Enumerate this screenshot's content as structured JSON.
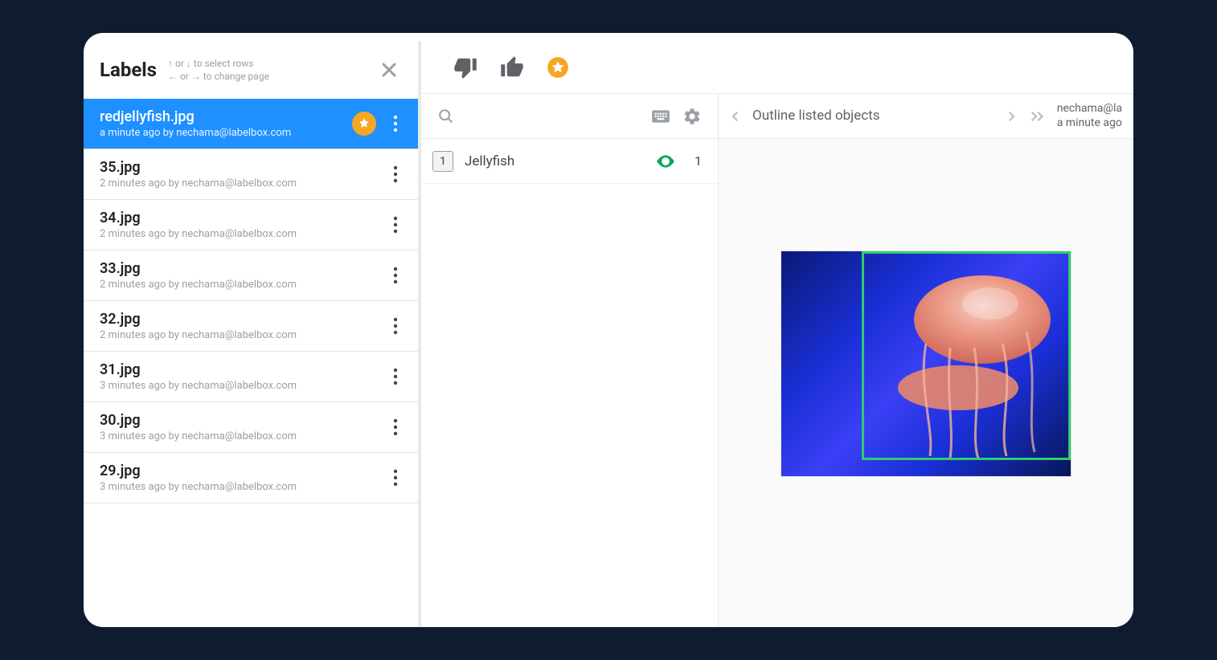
{
  "sidebar": {
    "title": "Labels",
    "hint_line1": "↑ or ↓ to select rows",
    "hint_line2": "← or → to change page",
    "items": [
      {
        "name": "redjellyfish.jpg",
        "meta": "a minute ago by nechama@labelbox.com",
        "selected": true,
        "starred": true
      },
      {
        "name": "35.jpg",
        "meta": "2 minutes ago by nechama@labelbox.com"
      },
      {
        "name": "34.jpg",
        "meta": "2 minutes ago by nechama@labelbox.com"
      },
      {
        "name": "33.jpg",
        "meta": "2 minutes ago by nechama@labelbox.com"
      },
      {
        "name": "32.jpg",
        "meta": "2 minutes ago by nechama@labelbox.com"
      },
      {
        "name": "31.jpg",
        "meta": "3 minutes ago by nechama@labelbox.com"
      },
      {
        "name": "30.jpg",
        "meta": "3 minutes ago by nechama@labelbox.com"
      },
      {
        "name": "29.jpg",
        "meta": "3 minutes ago by nechama@labelbox.com"
      }
    ]
  },
  "objects": {
    "hotkey": "1",
    "name": "Jellyfish",
    "count": "1"
  },
  "right": {
    "outline_title": "Outline listed objects",
    "user": "nechama@la",
    "time": "a minute ago"
  }
}
